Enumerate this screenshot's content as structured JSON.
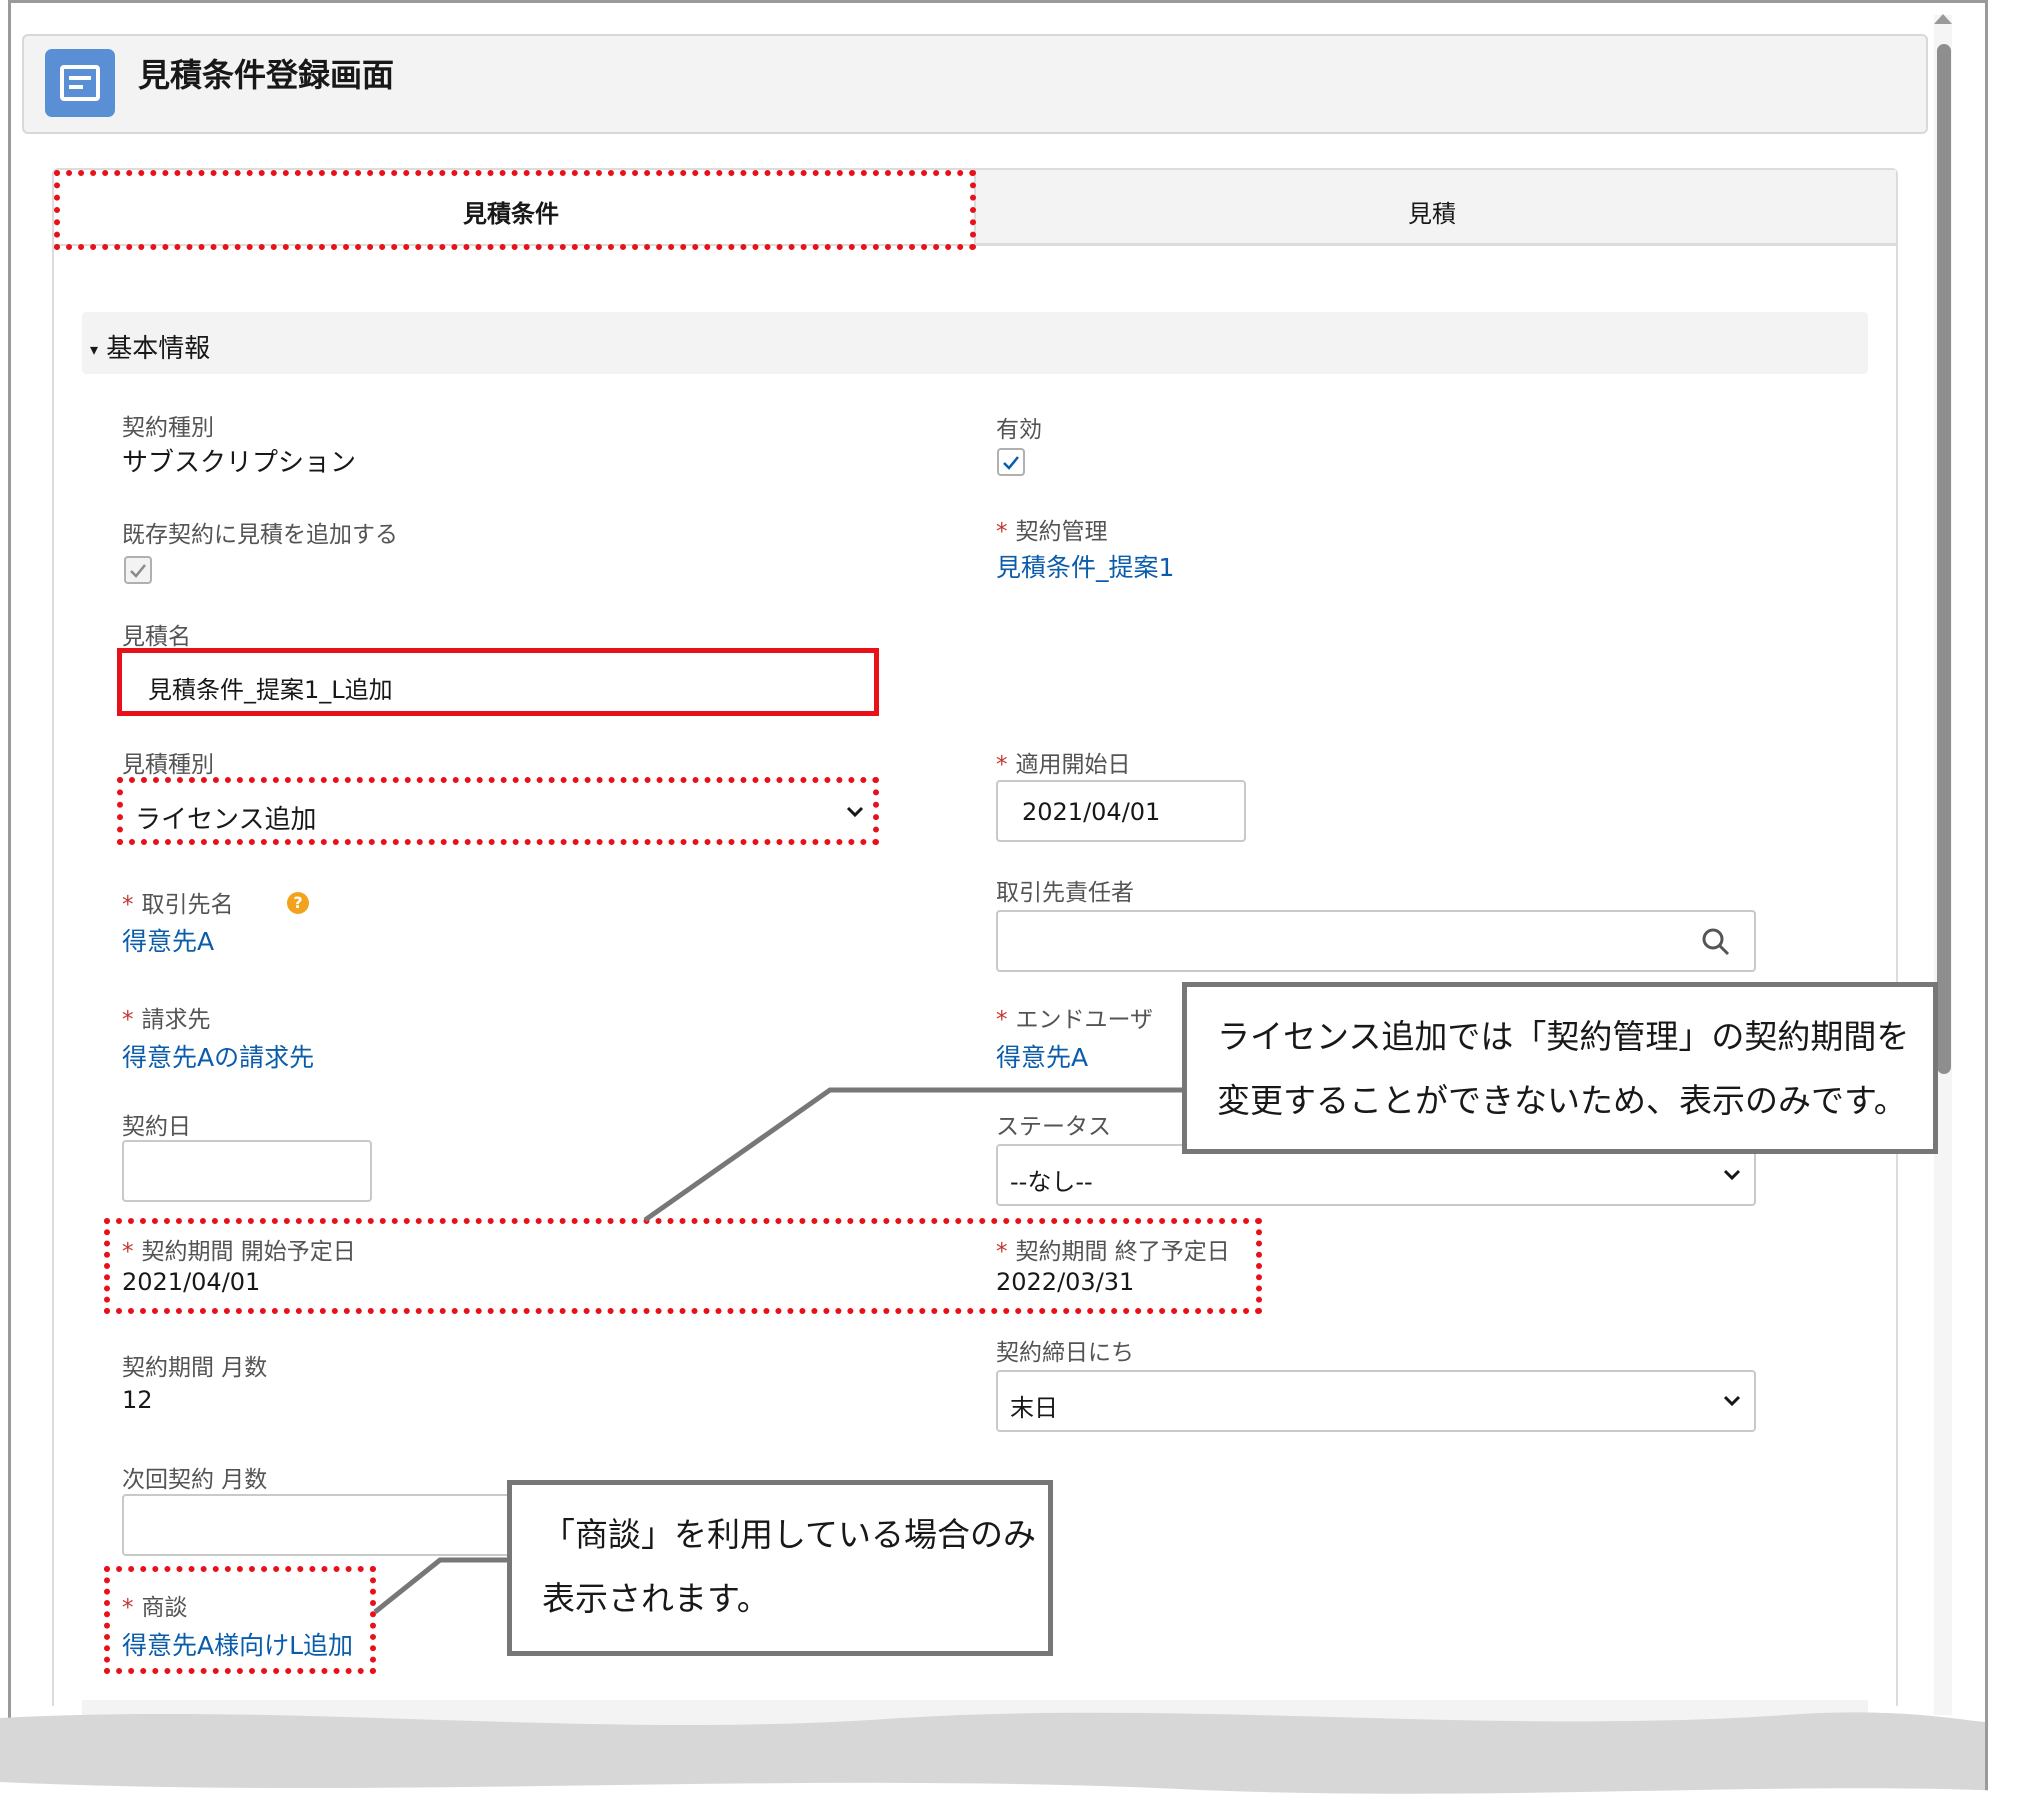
{
  "window": {
    "title": "見積条件登録画面"
  },
  "tabs": [
    {
      "label": "見積条件"
    },
    {
      "label": "見積"
    }
  ],
  "section": {
    "label": "基本情報",
    "toggle": "▾"
  },
  "fields": {
    "contract_type": {
      "label": "契約種別",
      "value": "サブスクリプション"
    },
    "active": {
      "label": "有効",
      "checked": true
    },
    "add_to_existing": {
      "label": "既存契約に見積を追加する",
      "checked": true
    },
    "contract_mgmt": {
      "label": "契約管理",
      "required_mark": "*",
      "value": "見積条件_提案1"
    },
    "quote_name": {
      "label": "見積名",
      "value": "見積条件_提案1_L追加"
    },
    "quote_type": {
      "label": "見積種別",
      "value": "ライセンス追加"
    },
    "apply_start": {
      "label": "適用開始日",
      "required_mark": "*",
      "value": "2021/04/01"
    },
    "account": {
      "label": "取引先名",
      "required_mark": "*",
      "value": "得意先A"
    },
    "account_contact": {
      "label": "取引先責任者",
      "value": ""
    },
    "billing": {
      "label": "請求先",
      "required_mark": "*",
      "value": "得意先Aの請求先"
    },
    "end_user": {
      "label": "エンドユーザ",
      "required_mark": "*",
      "value": "得意先A"
    },
    "contract_date": {
      "label": "契約日",
      "value": ""
    },
    "status": {
      "label": "ステータス",
      "value": "--なし--"
    },
    "period_start": {
      "label": "契約期間 開始予定日",
      "required_mark": "*",
      "value": "2021/04/01"
    },
    "period_end": {
      "label": "契約期間 終了予定日",
      "required_mark": "*",
      "value": "2022/03/31"
    },
    "period_months": {
      "label": "契約期間 月数",
      "value": "12"
    },
    "closing_day": {
      "label": "契約締日にち",
      "value": "末日"
    },
    "next_months": {
      "label": "次回契約 月数",
      "value": ""
    },
    "opportunity": {
      "label": "商談",
      "required_mark": "*",
      "value": "得意先A様向けL追加"
    }
  },
  "callouts": {
    "period": {
      "line1": "ライセンス追加では「契約管理」の契約期間を",
      "line2": "変更することができないため、表示のみです。"
    },
    "opportunity": {
      "line1": "「商談」を利用している場合のみ",
      "line2": "表示されます。"
    }
  },
  "colors": {
    "link": "#0b5cab",
    "required": "#c23934",
    "highlight": "#e8111a",
    "header_icon": "#5a8fd6"
  }
}
